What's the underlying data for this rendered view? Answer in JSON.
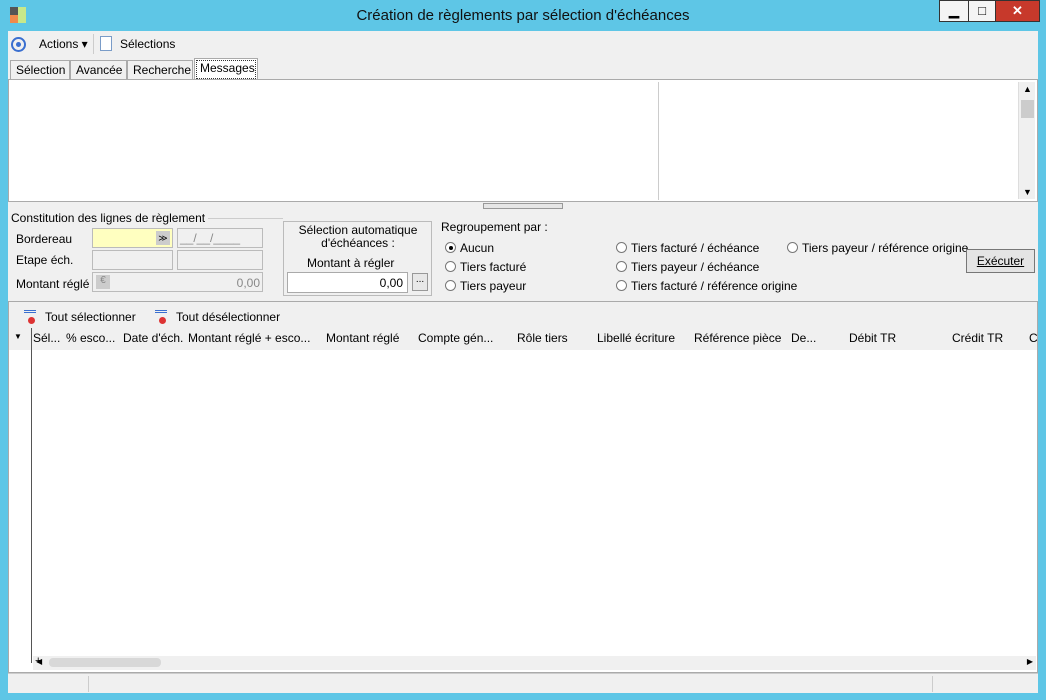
{
  "window": {
    "title": "Création de règlements par sélection d'échéances",
    "min": "▁",
    "max": "□",
    "close": "✕"
  },
  "toolbar": {
    "actions": "Actions ▾",
    "selections": "Sélections"
  },
  "tabs": [
    "Sélection",
    "Avancée",
    "Recherche",
    "Messages"
  ],
  "constitution": {
    "legend": "Constitution des lignes de règlement",
    "bordereau": "Bordereau",
    "date_mask": "__/__/____",
    "etape": "Etape éch.",
    "montant_regle": "Montant réglé",
    "montant_value": "0,00"
  },
  "auto": {
    "title": "Sélection automatique d'échéances :",
    "label": "Montant à régler",
    "value": "0,00",
    "browse": "..."
  },
  "regroupement": {
    "title": "Regroupement par :",
    "options": [
      "Aucun",
      "Tiers facturé",
      "Tiers payeur",
      "Tiers facturé / échéance",
      "Tiers payeur / échéance",
      "Tiers facturé / référence origine",
      "Tiers payeur / référence origine"
    ],
    "selected": "Aucun"
  },
  "executer": "Exécuter",
  "grid": {
    "select_all": "Tout sélectionner",
    "deselect_all": "Tout désélectionner",
    "columns": [
      "Sél...",
      "% esco...",
      "Date d'éch.",
      "Montant réglé + esco...",
      "Montant réglé",
      "Compte gén...",
      "Rôle tiers",
      "Libellé écriture",
      "Référence pièce",
      "De...",
      "Débit TR",
      "Crédit TR",
      "C"
    ]
  },
  "colors": {
    "titlebar": "#5ec6e6",
    "input_yellow": "#ffffc0"
  }
}
